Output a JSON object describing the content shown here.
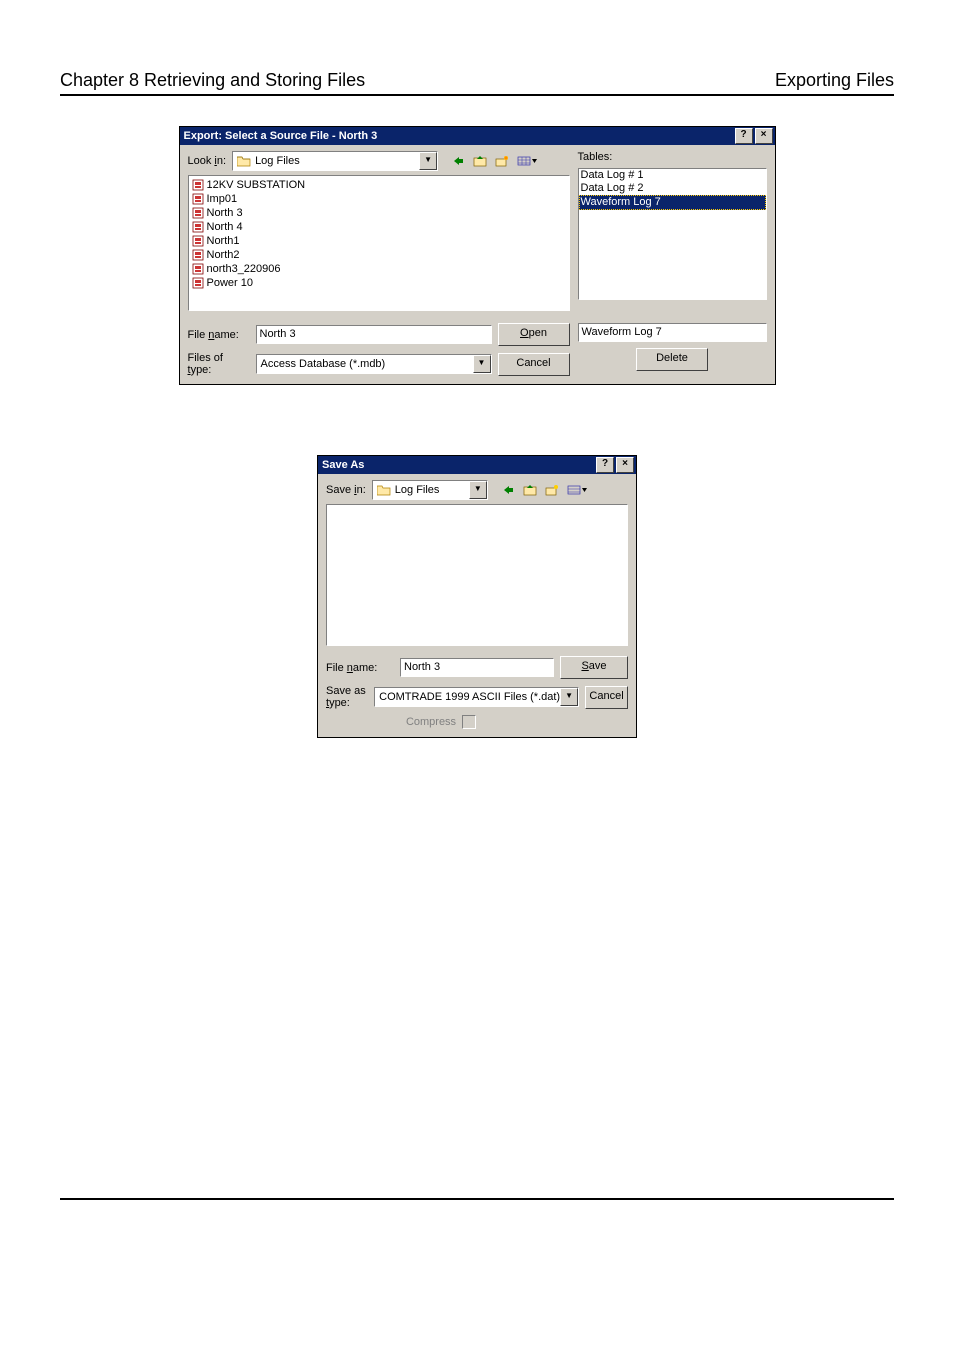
{
  "page_header": {
    "left": "Chapter 8 Retrieving and Storing Files",
    "right": "Exporting Files"
  },
  "dialog1": {
    "title": "Export: Select a Source File - North 3",
    "help_btn": "?",
    "close_btn": "×",
    "lookin_label_prefix": "Look ",
    "lookin_label_u": "i",
    "lookin_label_suffix": "n:",
    "lookin_value": "Log Files",
    "files": [
      "12KV SUBSTATION",
      "Imp01",
      "North 3",
      "North 4",
      "North1",
      "North2",
      "north3_220906",
      "Power 10"
    ],
    "tables_label": "Tables:",
    "tables": [
      {
        "name": "Data Log # 1",
        "selected": false
      },
      {
        "name": "Data Log # 2",
        "selected": false
      },
      {
        "name": "Waveform Log 7",
        "selected": true
      }
    ],
    "filename_label_prefix": "File ",
    "filename_label_u": "n",
    "filename_label_suffix": "ame:",
    "filename_value": "North 3",
    "filetype_label_prefix": "Files of ",
    "filetype_label_u": "t",
    "filetype_label_suffix": "ype:",
    "filetype_value": "Access Database (*.mdb)",
    "open_btn_u": "O",
    "open_btn_rest": "pen",
    "cancel_btn": "Cancel",
    "selected_table_display": "Waveform Log 7",
    "delete_btn": "Delete"
  },
  "dialog2": {
    "title": "Save As",
    "help_btn": "?",
    "close_btn": "×",
    "savein_label_prefix": "Save ",
    "savein_label_u": "i",
    "savein_label_suffix": "n:",
    "savein_value": "Log Files",
    "filename_label_prefix": "File ",
    "filename_label_u": "n",
    "filename_label_suffix": "ame:",
    "filename_value": "North 3",
    "saveastype_label_prefix": "Save as ",
    "saveastype_label_u": "t",
    "saveastype_label_suffix": "ype:",
    "saveastype_value": "COMTRADE 1999 ASCII Files (*.dat)",
    "save_btn_u": "S",
    "save_btn_rest": "ave",
    "cancel_btn": "Cancel",
    "compress_label": "Compress"
  },
  "icons": {
    "nav_back": "back-arrow-icon",
    "nav_up": "up-folder-icon",
    "nav_new": "new-folder-icon",
    "nav_view": "list-view-icon",
    "dropdown": "▼"
  }
}
